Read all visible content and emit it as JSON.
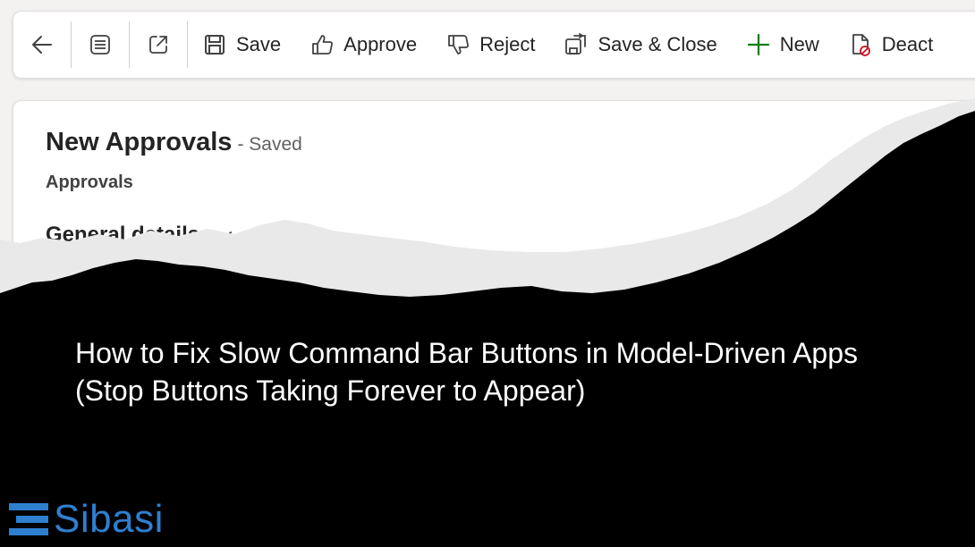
{
  "command_bar": {
    "buttons": [
      {
        "label": "Save",
        "icon": "save-icon"
      },
      {
        "label": "Approve",
        "icon": "thumbs-up-icon"
      },
      {
        "label": "Reject",
        "icon": "thumbs-down-icon"
      },
      {
        "label": "Save & Close",
        "icon": "save-close-icon"
      },
      {
        "label": "New",
        "icon": "plus-icon"
      },
      {
        "label": "Deact",
        "icon": "deactivate-icon"
      }
    ],
    "icons": [
      "back-arrow-icon",
      "form-list-icon",
      "open-new-window-icon"
    ]
  },
  "record": {
    "title": "New Approvals",
    "status": "- Saved",
    "entity": "Approvals",
    "view_label": "General  details"
  },
  "overlay": {
    "headline": "How to Fix Slow Command Bar Buttons in Model-Driven Apps (Stop Buttons Taking Forever to Appear)",
    "brand_name": "Sibasi",
    "colors": {
      "background": "#000000",
      "headline": "#ffffff",
      "brand": "#2f7fd0",
      "torn_edge": "#e9e9e9"
    }
  }
}
